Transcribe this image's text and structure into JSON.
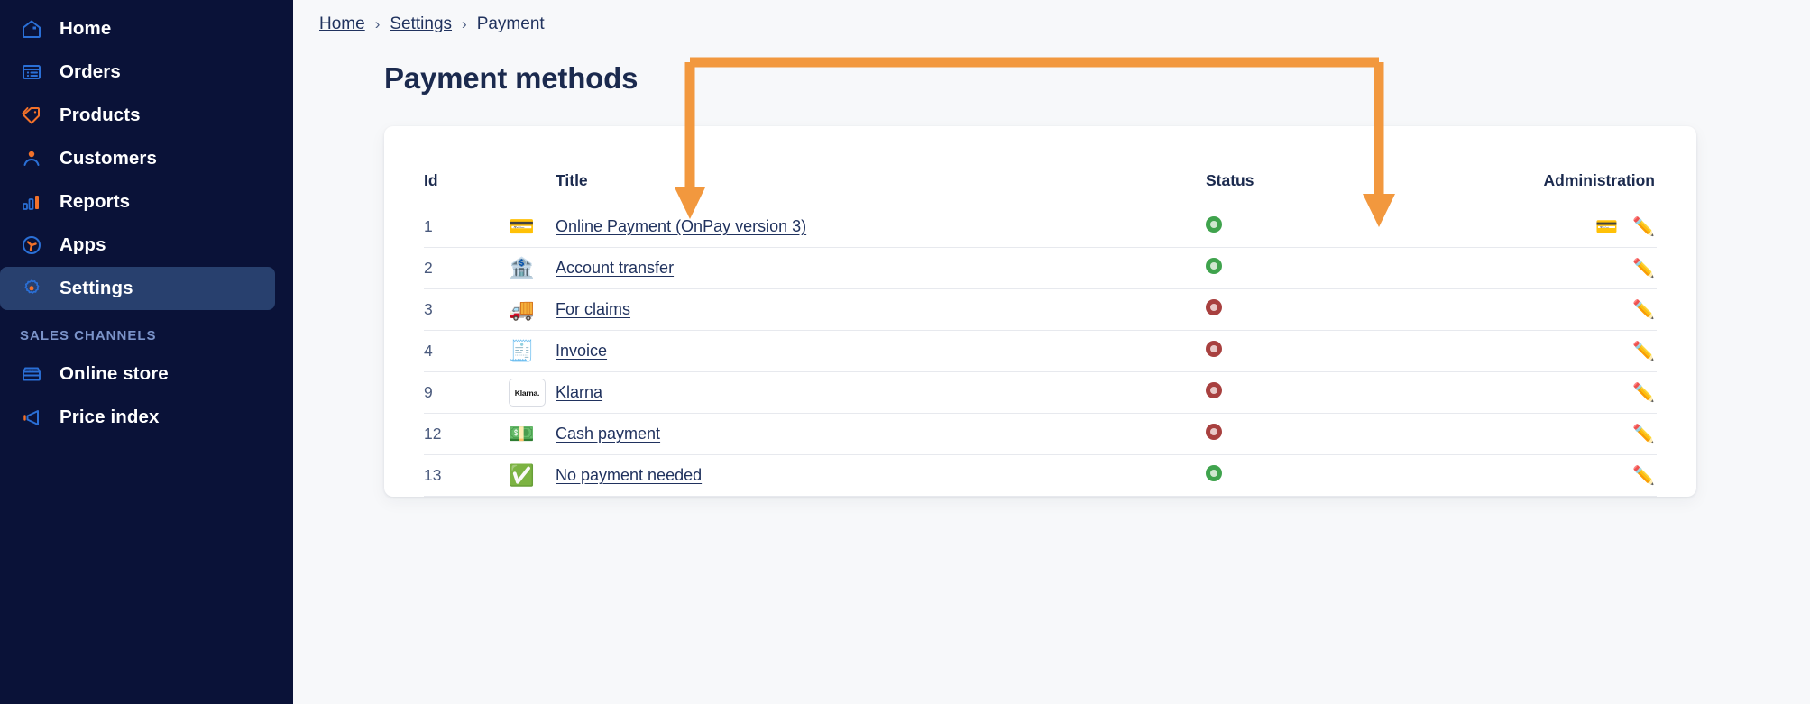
{
  "sidebar": {
    "items": [
      {
        "label": "Home",
        "icon": "home-icon",
        "active": false
      },
      {
        "label": "Orders",
        "icon": "orders-icon",
        "active": false
      },
      {
        "label": "Products",
        "icon": "tag-icon",
        "active": false
      },
      {
        "label": "Customers",
        "icon": "person-icon",
        "active": false
      },
      {
        "label": "Reports",
        "icon": "bar-chart-icon",
        "active": false
      },
      {
        "label": "Apps",
        "icon": "apps-icon",
        "active": false
      },
      {
        "label": "Settings",
        "icon": "gear-icon",
        "active": true
      }
    ],
    "section_label": "SALES CHANNELS",
    "channels": [
      {
        "label": "Online store",
        "icon": "storefront-icon"
      },
      {
        "label": "Price index",
        "icon": "megaphone-icon"
      }
    ]
  },
  "breadcrumb": {
    "home": "Home",
    "settings": "Settings",
    "current": "Payment",
    "separator": "›"
  },
  "page": {
    "title": "Payment methods"
  },
  "table": {
    "headers": {
      "id": "Id",
      "icon": "",
      "title": "Title",
      "status": "Status",
      "administration": "Administration"
    },
    "rows": [
      {
        "id": "1",
        "icon": "💳",
        "icon_name": "credit-card-emoji",
        "title": "Online Payment (OnPay version 3)",
        "status": "active",
        "actions": [
          "card-settings-icon",
          "edit-pencil-icon"
        ]
      },
      {
        "id": "2",
        "icon": "🏦",
        "icon_name": "bank-emoji",
        "title": "Account transfer",
        "status": "active",
        "actions": [
          "edit-pencil-icon"
        ]
      },
      {
        "id": "3",
        "icon": "🚚",
        "icon_name": "truck-emoji",
        "title": "For claims",
        "status": "inactive",
        "actions": [
          "edit-pencil-icon"
        ]
      },
      {
        "id": "4",
        "icon": "🧾",
        "icon_name": "receipt-emoji",
        "title": "Invoice",
        "status": "inactive",
        "actions": [
          "edit-pencil-icon"
        ]
      },
      {
        "id": "9",
        "icon": "Klarna.",
        "icon_name": "klarna-logo",
        "title": "Klarna",
        "status": "inactive",
        "actions": [
          "edit-pencil-icon"
        ]
      },
      {
        "id": "12",
        "icon": "💵",
        "icon_name": "banknote-emoji",
        "title": "Cash payment",
        "status": "inactive",
        "actions": [
          "edit-pencil-icon"
        ]
      },
      {
        "id": "13",
        "icon": "✅",
        "icon_name": "green-check-emoji",
        "title": "No payment needed",
        "status": "active",
        "actions": [
          "edit-pencil-icon"
        ]
      }
    ]
  },
  "icons": {
    "card_settings": "💳",
    "edit_pencil": "✏️"
  },
  "colors": {
    "sidebar_bg": "#0a1238",
    "sidebar_active": "#28406e",
    "accent_orange": "#f2983e",
    "status_active": "#3fa34d",
    "status_inactive": "#a8403f",
    "link": "#20325e",
    "page_bg": "#f7f8fa"
  },
  "annotation": {
    "type": "bracket-arrow",
    "color": "#f2983e",
    "label": ""
  }
}
